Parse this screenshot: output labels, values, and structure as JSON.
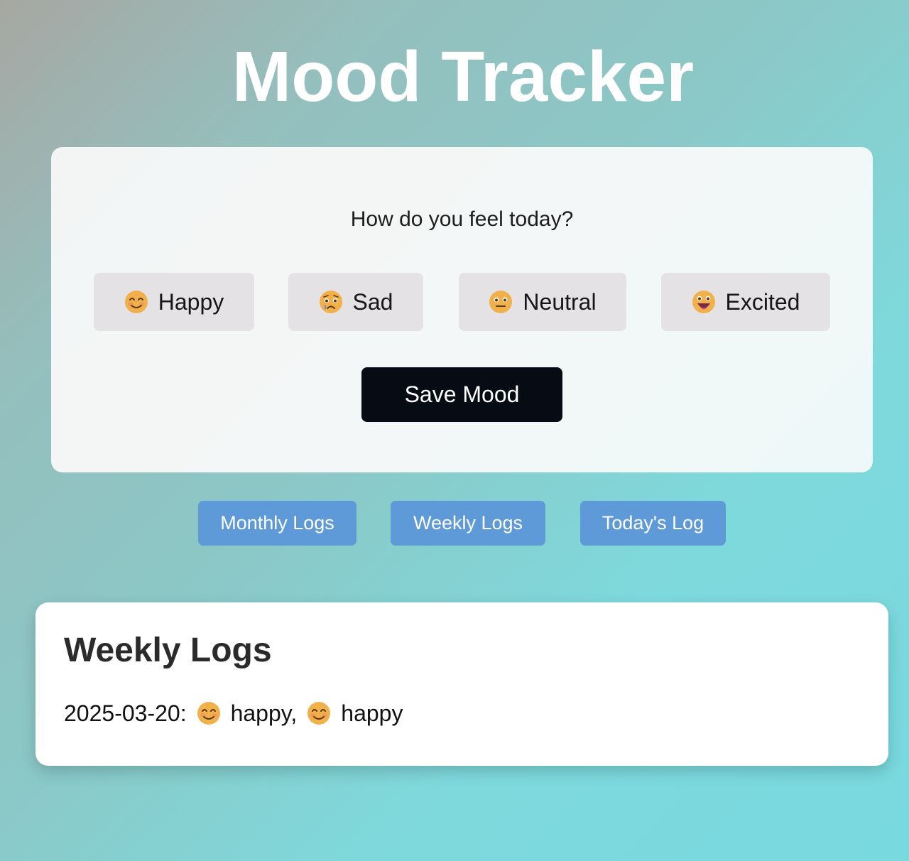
{
  "header": {
    "title": "Mood Tracker"
  },
  "mood_card": {
    "question": "How do you feel today?",
    "moods": [
      {
        "label": "Happy",
        "icon": "smiling-face-icon"
      },
      {
        "label": "Sad",
        "icon": "crying-face-icon"
      },
      {
        "label": "Neutral",
        "icon": "neutral-face-icon"
      },
      {
        "label": "Excited",
        "icon": "grinning-face-icon"
      }
    ],
    "save_label": "Save Mood"
  },
  "log_nav": {
    "monthly": "Monthly Logs",
    "weekly": "Weekly Logs",
    "today": "Today's Log"
  },
  "log_panel": {
    "title": "Weekly Logs",
    "entries": [
      {
        "date": "2025-03-20:",
        "moods": [
          "happy,",
          "happy"
        ]
      }
    ]
  },
  "colors": {
    "save_button": "#070c14",
    "log_button": "#5e9ad8",
    "mood_button": "#e4e2e4",
    "emoji_yellow": "#f2b04a"
  }
}
